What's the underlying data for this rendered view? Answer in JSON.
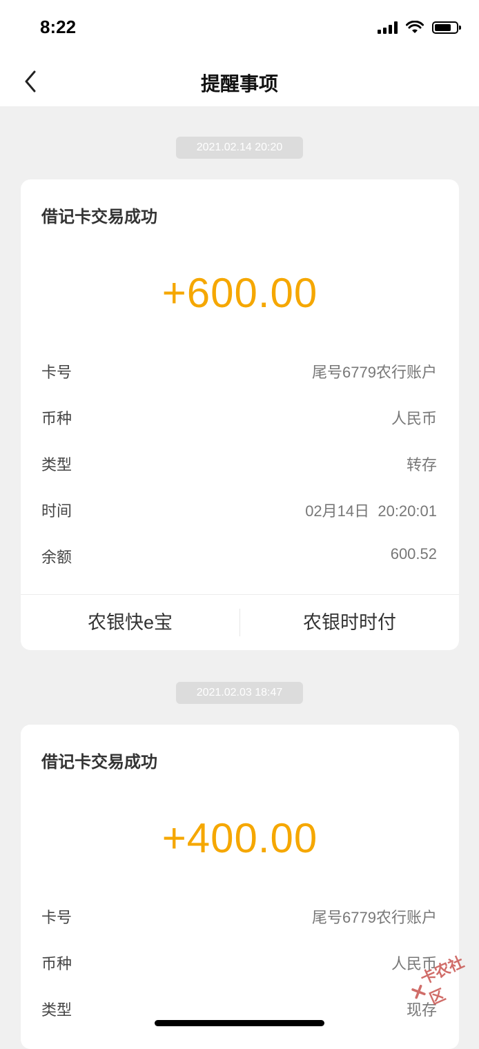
{
  "status": {
    "time": "8:22"
  },
  "nav": {
    "title": "提醒事项"
  },
  "messages": [
    {
      "date": "2021.02.14 20:20",
      "title": "借记卡交易成功",
      "amount": "+600.00",
      "rows": [
        {
          "label": "卡号",
          "value": "尾号6779农行账户"
        },
        {
          "label": "币种",
          "value": "人民币"
        },
        {
          "label": "类型",
          "value": "转存"
        },
        {
          "label": "时间",
          "value": "02月14日  20:20:01"
        },
        {
          "label": "余额",
          "value": "600.52"
        }
      ],
      "actions": [
        "农银快e宝",
        "农银时时付"
      ]
    },
    {
      "date": "2021.02.03 18:47",
      "title": "借记卡交易成功",
      "amount": "+400.00",
      "rows": [
        {
          "label": "卡号",
          "value": "尾号6779农行账户"
        },
        {
          "label": "币种",
          "value": "人民币"
        },
        {
          "label": "类型",
          "value": "现存"
        }
      ]
    }
  ],
  "watermark": {
    "text": "卡农社区"
  },
  "colors": {
    "amount": "#f5a700",
    "background": "#f0f0f0",
    "date_pill": "#dcdcdc"
  }
}
